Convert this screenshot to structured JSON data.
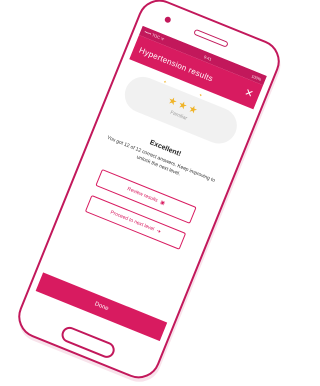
{
  "status_bar": {
    "carrier": "••••• TOC ᯤ",
    "time": "9:41",
    "battery": "100%"
  },
  "app_bar": {
    "title": "Hypertension results",
    "close_icon": "close-icon"
  },
  "rating": {
    "stars": 3,
    "label": "Familiar"
  },
  "result": {
    "headline": "Excellent!",
    "message": "You got 12 of 12 correct answers. Keep improving to unlock the next level."
  },
  "buttons": {
    "review_label": "Review results",
    "proceed_label": "Proceed to next level",
    "done_label": "Done"
  },
  "colors": {
    "brand": "#d81b60",
    "star": "#f0b429"
  }
}
